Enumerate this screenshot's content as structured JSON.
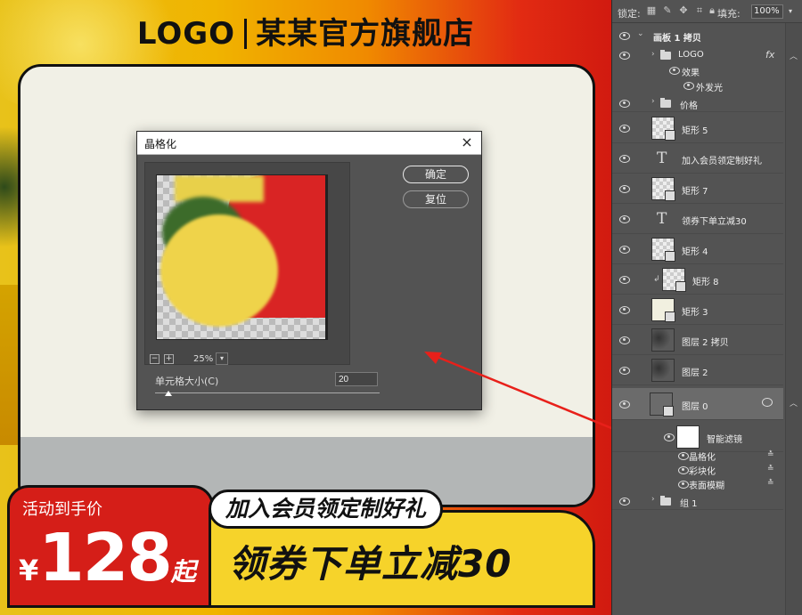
{
  "store": {
    "logo": "LOGO",
    "name": "某某官方旗舰店"
  },
  "promo": {
    "label": "活动到手价",
    "currency": "¥",
    "price": "128",
    "suffix": "起",
    "tagline": "加入会员领定制好礼",
    "coupon": "领券下单立减30"
  },
  "dialog": {
    "title": "晶格化",
    "close": "×",
    "ok": "确定",
    "reset": "复位",
    "zoom_minus": "−",
    "zoom_plus": "+",
    "zoom": "25%",
    "cell_size_label": "单元格大小(C)",
    "cell_size_value": "20",
    "cell_size_fraction": 0.06
  },
  "layers_panel": {
    "lock_label": "锁定:",
    "fill_label": "填充:",
    "fill_value": "100%",
    "artboard": "画板 1 拷贝",
    "layers": [
      {
        "name": "LOGO",
        "type": "group",
        "fx": "fx"
      },
      {
        "name": "效果",
        "type": "effect"
      },
      {
        "name": "外发光",
        "type": "effect-item"
      },
      {
        "name": "价格",
        "type": "group"
      },
      {
        "name": "矩形 5",
        "type": "shape"
      },
      {
        "name": "加入会员领定制好礼",
        "type": "text"
      },
      {
        "name": "矩形 7",
        "type": "shape"
      },
      {
        "name": "领券下单立减30",
        "type": "text"
      },
      {
        "name": "矩形 4",
        "type": "shape"
      },
      {
        "name": "矩形 8",
        "type": "shape"
      },
      {
        "name": "矩形 3",
        "type": "shape"
      },
      {
        "name": "图层 2 拷贝",
        "type": "pixel"
      },
      {
        "name": "图层 2",
        "type": "pixel"
      },
      {
        "name": "图层 0",
        "type": "smart",
        "active": true
      },
      {
        "name": "智能滤镜",
        "type": "smart-filter"
      },
      {
        "name": "晶格化",
        "type": "filter"
      },
      {
        "name": "彩块化",
        "type": "filter"
      },
      {
        "name": "表面模糊",
        "type": "filter"
      },
      {
        "name": "组 1",
        "type": "group"
      }
    ]
  },
  "colors": {
    "accent_red": "#d51e18",
    "accent_yellow": "#f6d32a",
    "arrow": "#e8201a",
    "panel_bg": "#535353"
  }
}
